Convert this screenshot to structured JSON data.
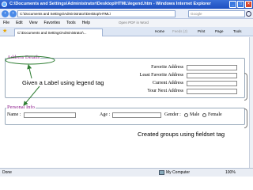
{
  "window": {
    "title": "C:\\Documents and Settings\\Administrator\\Desktop\\HTML\\legend.htm - Windows Internet Explorer"
  },
  "addressbar": {
    "url": "C:\\Documents and Settings\\Administrator\\Desktop\\HTML\\",
    "search_placeholder": "Google"
  },
  "menu": {
    "items": [
      "File",
      "Edit",
      "View",
      "Favorites",
      "Tools",
      "Help"
    ],
    "pdf_label": "Open PDF in Word"
  },
  "tabbar": {
    "tab_title": "C:\\Documents and Settings\\Administrator\\...",
    "home_label": "Home",
    "feeds_label": "Feeds (J)",
    "print_label": "Print",
    "page_label": "Page",
    "tools_label": "Tools"
  },
  "page": {
    "address_legend": "Address Details",
    "address_labels": [
      "Favorite Address",
      "Least Favorite Address",
      "Current Address",
      "Your Next Address"
    ],
    "personal_legend": "Personal Info",
    "name_label": "Name :",
    "age_label": "Age :",
    "gender_label": "Gender :",
    "male_label": "Male",
    "female_label": "Female"
  },
  "annotations": {
    "legend_note": "Given a Label using legend tag",
    "fieldset_note": "Created groups using fieldset tag"
  },
  "statusbar": {
    "status": "Done",
    "zone": "My Computer",
    "zoom": "100%"
  },
  "colors": {
    "legend_text": "#8b1a8b",
    "arrow": "#2e7d32",
    "titlebar": "#1d4fc0"
  }
}
